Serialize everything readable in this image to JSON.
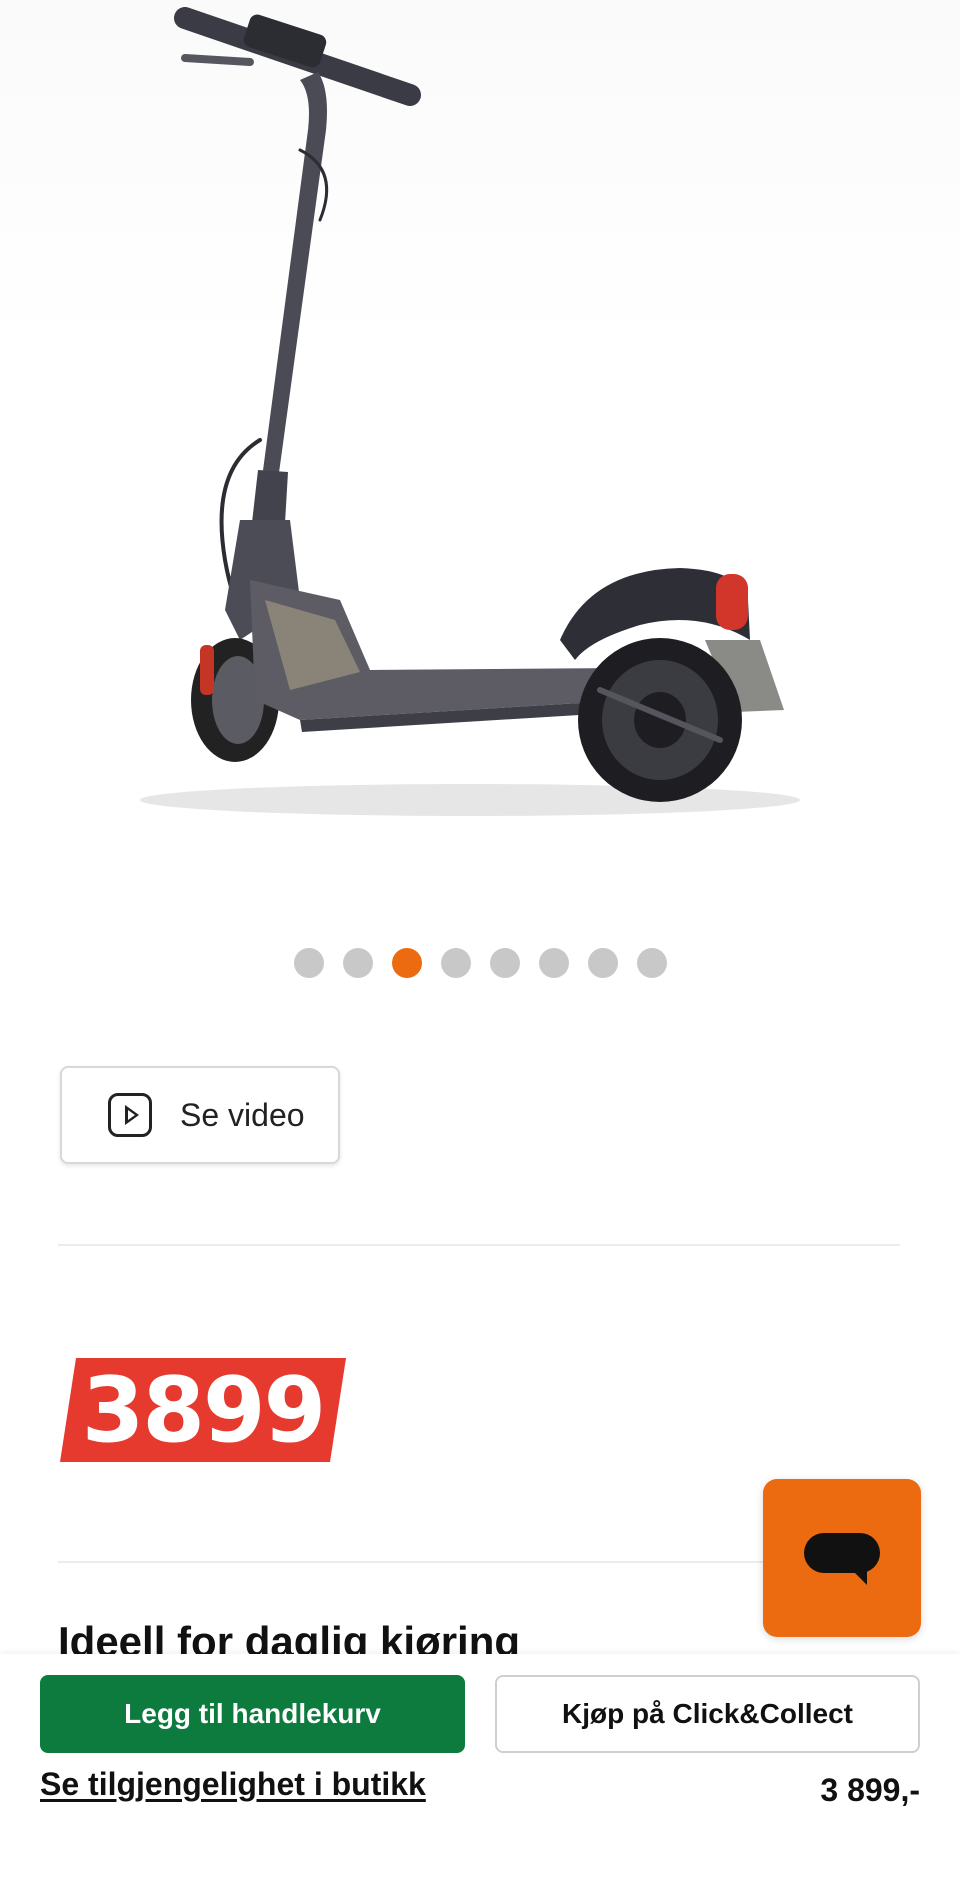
{
  "product": {
    "image_alt": "electric-scooter",
    "gallery": {
      "total": 8,
      "active_index": 2
    }
  },
  "video": {
    "label": "Se video"
  },
  "price": {
    "badge": "3899",
    "footer": "3 899,-"
  },
  "section": {
    "heading": "Ideell for daglig kjøring"
  },
  "actions": {
    "add_to_cart": "Legg til handlekurv",
    "click_collect": "Kjøp på Click&Collect",
    "availability_link": "Se tilgjengelighet i butikk"
  },
  "colors": {
    "accent_orange": "#ed6b10",
    "price_red": "#e63a2e",
    "cart_green": "#0d7a3e"
  },
  "icons": {
    "video": "play-icon",
    "chat": "chat-icon"
  }
}
